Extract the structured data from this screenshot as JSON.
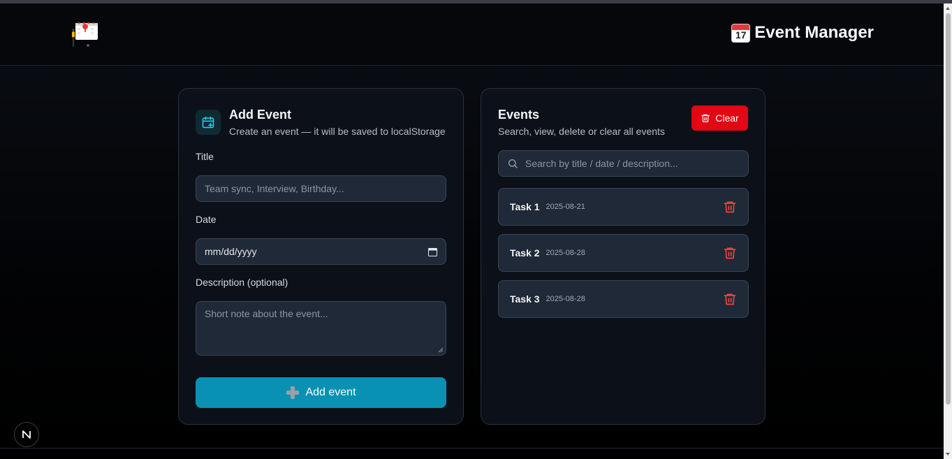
{
  "header": {
    "title": "Event Manager",
    "calendar_badge_number": "17"
  },
  "add_card": {
    "title": "Add Event",
    "subtitle": "Create an event — it will be saved to localStorage",
    "title_label": "Title",
    "title_placeholder": "Team sync, Interview, Birthday...",
    "date_label": "Date",
    "date_value": "mm/dd/yyyy",
    "description_label": "Description (optional)",
    "description_placeholder": "Short note about the event...",
    "submit_label": "Add event"
  },
  "events_card": {
    "title": "Events",
    "subtitle": "Search, view, delete or clear all events",
    "clear_label": "Clear",
    "search_placeholder": "Search by title / date / description...",
    "items": [
      {
        "title": "Task 1",
        "date": "2025-08-21"
      },
      {
        "title": "Task 2",
        "date": "2025-08-28"
      },
      {
        "title": "Task 3",
        "date": "2025-08-28"
      }
    ]
  },
  "dev_badge": {
    "letter": "N"
  },
  "colors": {
    "accent": "#0891b2",
    "danger": "#e30613",
    "trash_icon": "#ef4444",
    "card_bg": "#0c1119",
    "field_bg": "#1f2937"
  }
}
